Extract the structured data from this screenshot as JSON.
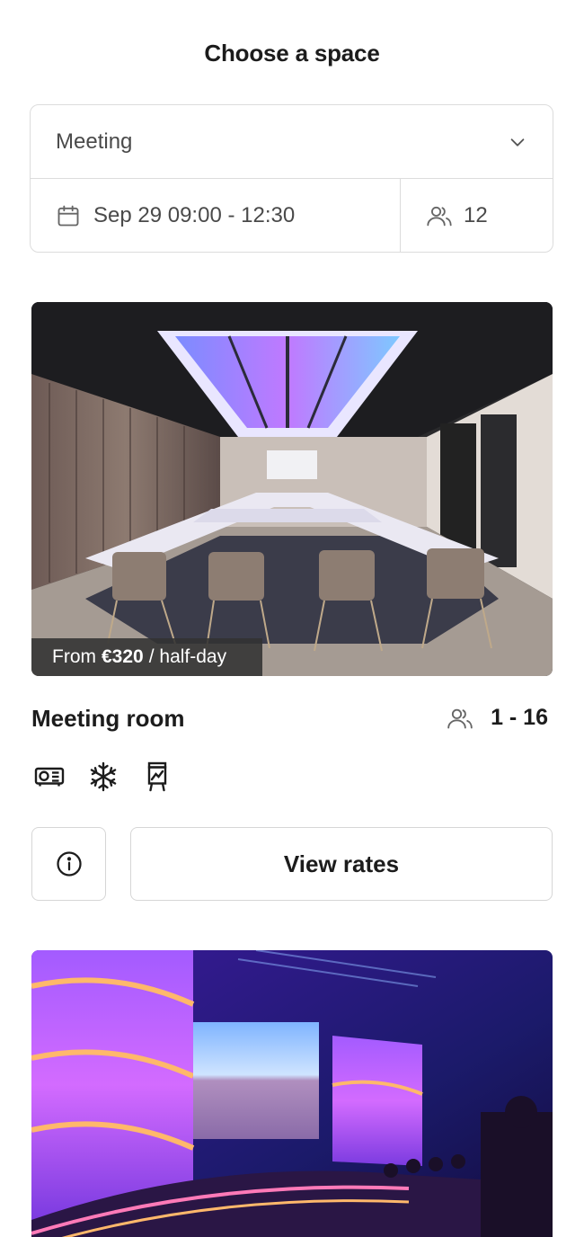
{
  "header": {
    "title": "Choose a space"
  },
  "filters": {
    "event_type": "Meeting",
    "date_time": "Sep 29 09:00 - 12:30",
    "guests": "12"
  },
  "spaces": [
    {
      "price_prefix": "From",
      "price": "€320",
      "price_suffix": "/ half-day",
      "name": "Meeting room",
      "capacity": "1 - 16",
      "amenities": [
        "projector-icon",
        "snowflake-icon",
        "flipchart-icon"
      ],
      "info_icon": "info-icon",
      "rates_label": "View rates"
    }
  ]
}
